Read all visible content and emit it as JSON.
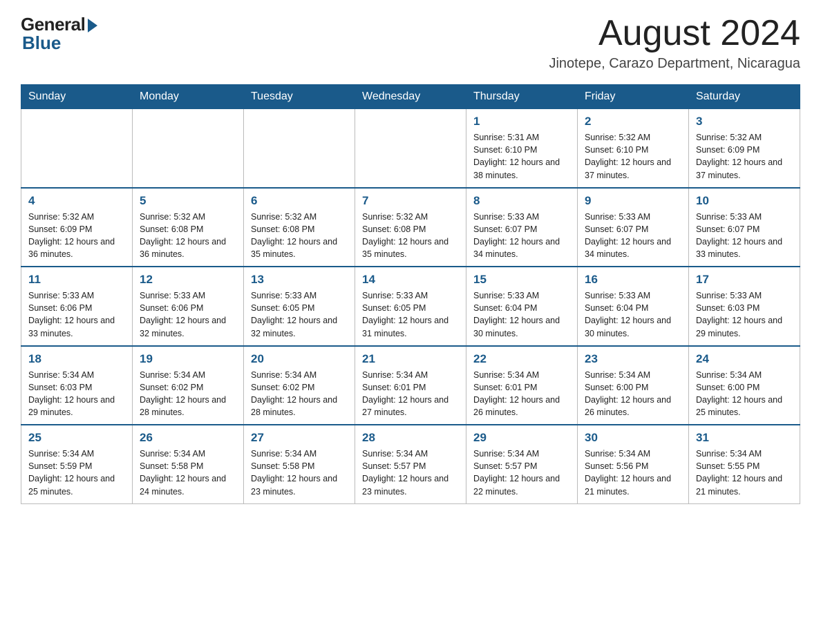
{
  "logo": {
    "general": "General",
    "blue": "Blue"
  },
  "title": {
    "month": "August 2024",
    "location": "Jinotepe, Carazo Department, Nicaragua"
  },
  "weekdays": [
    "Sunday",
    "Monday",
    "Tuesday",
    "Wednesday",
    "Thursday",
    "Friday",
    "Saturday"
  ],
  "weeks": [
    [
      {
        "day": "",
        "info": ""
      },
      {
        "day": "",
        "info": ""
      },
      {
        "day": "",
        "info": ""
      },
      {
        "day": "",
        "info": ""
      },
      {
        "day": "1",
        "info": "Sunrise: 5:31 AM\nSunset: 6:10 PM\nDaylight: 12 hours and 38 minutes."
      },
      {
        "day": "2",
        "info": "Sunrise: 5:32 AM\nSunset: 6:10 PM\nDaylight: 12 hours and 37 minutes."
      },
      {
        "day": "3",
        "info": "Sunrise: 5:32 AM\nSunset: 6:09 PM\nDaylight: 12 hours and 37 minutes."
      }
    ],
    [
      {
        "day": "4",
        "info": "Sunrise: 5:32 AM\nSunset: 6:09 PM\nDaylight: 12 hours and 36 minutes."
      },
      {
        "day": "5",
        "info": "Sunrise: 5:32 AM\nSunset: 6:08 PM\nDaylight: 12 hours and 36 minutes."
      },
      {
        "day": "6",
        "info": "Sunrise: 5:32 AM\nSunset: 6:08 PM\nDaylight: 12 hours and 35 minutes."
      },
      {
        "day": "7",
        "info": "Sunrise: 5:32 AM\nSunset: 6:08 PM\nDaylight: 12 hours and 35 minutes."
      },
      {
        "day": "8",
        "info": "Sunrise: 5:33 AM\nSunset: 6:07 PM\nDaylight: 12 hours and 34 minutes."
      },
      {
        "day": "9",
        "info": "Sunrise: 5:33 AM\nSunset: 6:07 PM\nDaylight: 12 hours and 34 minutes."
      },
      {
        "day": "10",
        "info": "Sunrise: 5:33 AM\nSunset: 6:07 PM\nDaylight: 12 hours and 33 minutes."
      }
    ],
    [
      {
        "day": "11",
        "info": "Sunrise: 5:33 AM\nSunset: 6:06 PM\nDaylight: 12 hours and 33 minutes."
      },
      {
        "day": "12",
        "info": "Sunrise: 5:33 AM\nSunset: 6:06 PM\nDaylight: 12 hours and 32 minutes."
      },
      {
        "day": "13",
        "info": "Sunrise: 5:33 AM\nSunset: 6:05 PM\nDaylight: 12 hours and 32 minutes."
      },
      {
        "day": "14",
        "info": "Sunrise: 5:33 AM\nSunset: 6:05 PM\nDaylight: 12 hours and 31 minutes."
      },
      {
        "day": "15",
        "info": "Sunrise: 5:33 AM\nSunset: 6:04 PM\nDaylight: 12 hours and 30 minutes."
      },
      {
        "day": "16",
        "info": "Sunrise: 5:33 AM\nSunset: 6:04 PM\nDaylight: 12 hours and 30 minutes."
      },
      {
        "day": "17",
        "info": "Sunrise: 5:33 AM\nSunset: 6:03 PM\nDaylight: 12 hours and 29 minutes."
      }
    ],
    [
      {
        "day": "18",
        "info": "Sunrise: 5:34 AM\nSunset: 6:03 PM\nDaylight: 12 hours and 29 minutes."
      },
      {
        "day": "19",
        "info": "Sunrise: 5:34 AM\nSunset: 6:02 PM\nDaylight: 12 hours and 28 minutes."
      },
      {
        "day": "20",
        "info": "Sunrise: 5:34 AM\nSunset: 6:02 PM\nDaylight: 12 hours and 28 minutes."
      },
      {
        "day": "21",
        "info": "Sunrise: 5:34 AM\nSunset: 6:01 PM\nDaylight: 12 hours and 27 minutes."
      },
      {
        "day": "22",
        "info": "Sunrise: 5:34 AM\nSunset: 6:01 PM\nDaylight: 12 hours and 26 minutes."
      },
      {
        "day": "23",
        "info": "Sunrise: 5:34 AM\nSunset: 6:00 PM\nDaylight: 12 hours and 26 minutes."
      },
      {
        "day": "24",
        "info": "Sunrise: 5:34 AM\nSunset: 6:00 PM\nDaylight: 12 hours and 25 minutes."
      }
    ],
    [
      {
        "day": "25",
        "info": "Sunrise: 5:34 AM\nSunset: 5:59 PM\nDaylight: 12 hours and 25 minutes."
      },
      {
        "day": "26",
        "info": "Sunrise: 5:34 AM\nSunset: 5:58 PM\nDaylight: 12 hours and 24 minutes."
      },
      {
        "day": "27",
        "info": "Sunrise: 5:34 AM\nSunset: 5:58 PM\nDaylight: 12 hours and 23 minutes."
      },
      {
        "day": "28",
        "info": "Sunrise: 5:34 AM\nSunset: 5:57 PM\nDaylight: 12 hours and 23 minutes."
      },
      {
        "day": "29",
        "info": "Sunrise: 5:34 AM\nSunset: 5:57 PM\nDaylight: 12 hours and 22 minutes."
      },
      {
        "day": "30",
        "info": "Sunrise: 5:34 AM\nSunset: 5:56 PM\nDaylight: 12 hours and 21 minutes."
      },
      {
        "day": "31",
        "info": "Sunrise: 5:34 AM\nSunset: 5:55 PM\nDaylight: 12 hours and 21 minutes."
      }
    ]
  ]
}
